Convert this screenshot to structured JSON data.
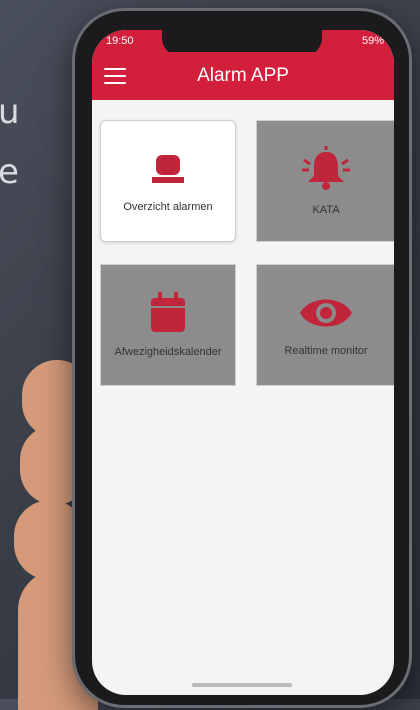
{
  "background": {
    "line1": "u",
    "line2": "e"
  },
  "status": {
    "time": "19:50",
    "battery": "59%"
  },
  "app": {
    "title": "Alarm APP"
  },
  "tiles": [
    {
      "label": "Overzicht alarmen",
      "icon": "siren-icon"
    },
    {
      "label": "KATA",
      "icon": "bell-icon"
    },
    {
      "label": "Afwezigheidskalender",
      "icon": "calendar-icon"
    },
    {
      "label": "Realtime monitor",
      "icon": "eye-icon"
    }
  ],
  "colors": {
    "brand": "#d21f3c",
    "icon": "#c0253c",
    "tile_gray": "#8c8c8c"
  }
}
